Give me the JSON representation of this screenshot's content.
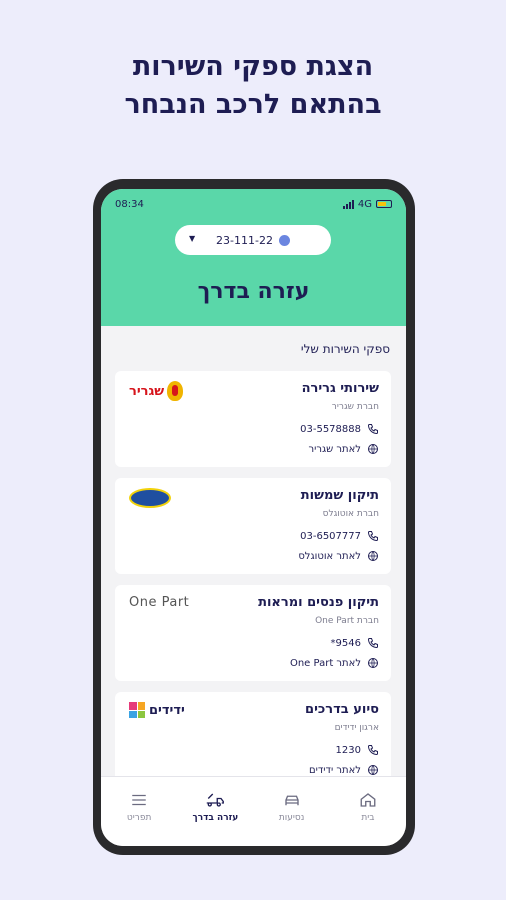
{
  "headline": {
    "line1": "הצגת ספקי השירות",
    "line2": "בהתאם לרכב הנבחר"
  },
  "status_bar": {
    "time": "08:34",
    "network": "4G"
  },
  "vehicle_selector": {
    "plate": "23-111-22"
  },
  "screen_title": "עזרה בדרך",
  "section_title": "ספקי השירות שלי",
  "providers": [
    {
      "service": "שירותי גרירה",
      "company": "חברת שגריר",
      "phone": "03-5578888",
      "website_label": "לאתר שגריר",
      "logo_text": "שגריר"
    },
    {
      "service": "תיקון שמשות",
      "company": "חברת אוטוגלס",
      "phone": "03-6507777",
      "website_label": "לאתר אוטוגלס",
      "logo_text": ""
    },
    {
      "service": "תיקון פנסים ומראות",
      "company": "חברת One Part",
      "phone": "*9546",
      "website_label": "לאתר One Part",
      "logo_text": "One Part"
    },
    {
      "service": "סיוע בדרכים",
      "company": "ארגון ידידים",
      "phone": "1230",
      "website_label": "לאתר ידידים",
      "logo_text": "ידידים"
    }
  ],
  "tabbar": {
    "items": [
      {
        "label": "בית",
        "icon": "home-icon"
      },
      {
        "label": "נסיעות",
        "icon": "car-icon"
      },
      {
        "label": "עזרה בדרך",
        "icon": "tow-truck-icon",
        "active": true
      },
      {
        "label": "תפריט",
        "icon": "menu-icon"
      }
    ]
  },
  "colors": {
    "accent": "#5ad7a9",
    "text": "#1e1d53",
    "background": "#ededfb"
  }
}
